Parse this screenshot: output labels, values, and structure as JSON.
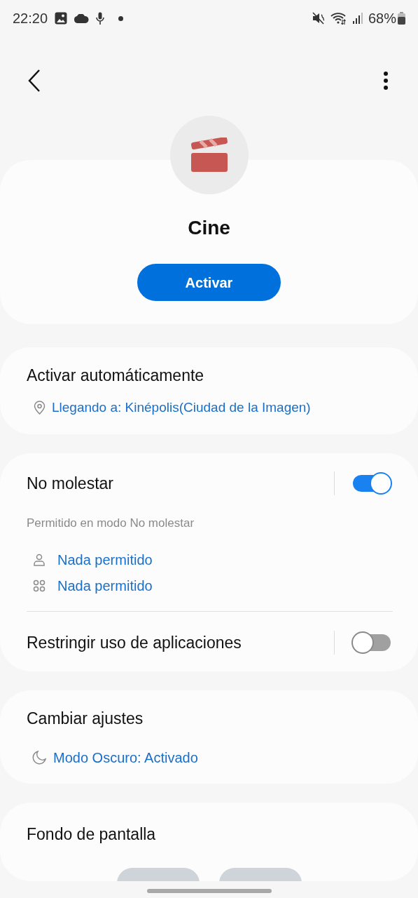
{
  "status_bar": {
    "time": "22:20",
    "battery": "68%"
  },
  "profile": {
    "title": "Cine",
    "button": "Activar"
  },
  "auto_activate": {
    "title": "Activar automáticamente",
    "condition": "Llegando a: Kinépolis(Ciudad de la Imagen)"
  },
  "do_not_disturb": {
    "title": "No molestar",
    "on": true,
    "subtitle": "Permitido en modo No molestar",
    "allowed": [
      {
        "kind": "people",
        "label": "Nada permitido"
      },
      {
        "kind": "apps",
        "label": "Nada permitido"
      }
    ]
  },
  "restrict_apps": {
    "title": "Restringir uso de aplicaciones",
    "on": false
  },
  "change_settings": {
    "title": "Cambiar ajustes",
    "setting": "Modo Oscuro: Activado"
  },
  "wallpaper": {
    "title": "Fondo de pantalla"
  }
}
